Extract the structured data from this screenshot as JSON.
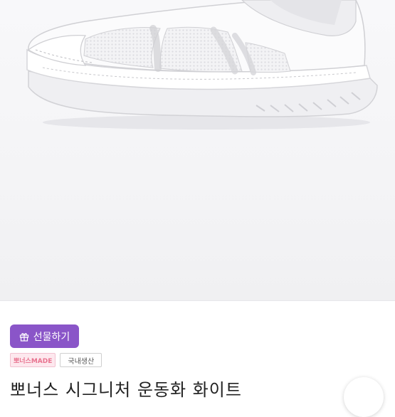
{
  "product": {
    "title": "뽀너스 시그니처 운동화 화이트",
    "image_alt": "white slip-on mesh sneaker"
  },
  "actions": {
    "gift_label": "선물하기",
    "gift_icon": "gift-icon",
    "gift_color": "#8a55c8"
  },
  "badges": {
    "brand": "뽀너스MADE",
    "origin": "국내생산"
  }
}
